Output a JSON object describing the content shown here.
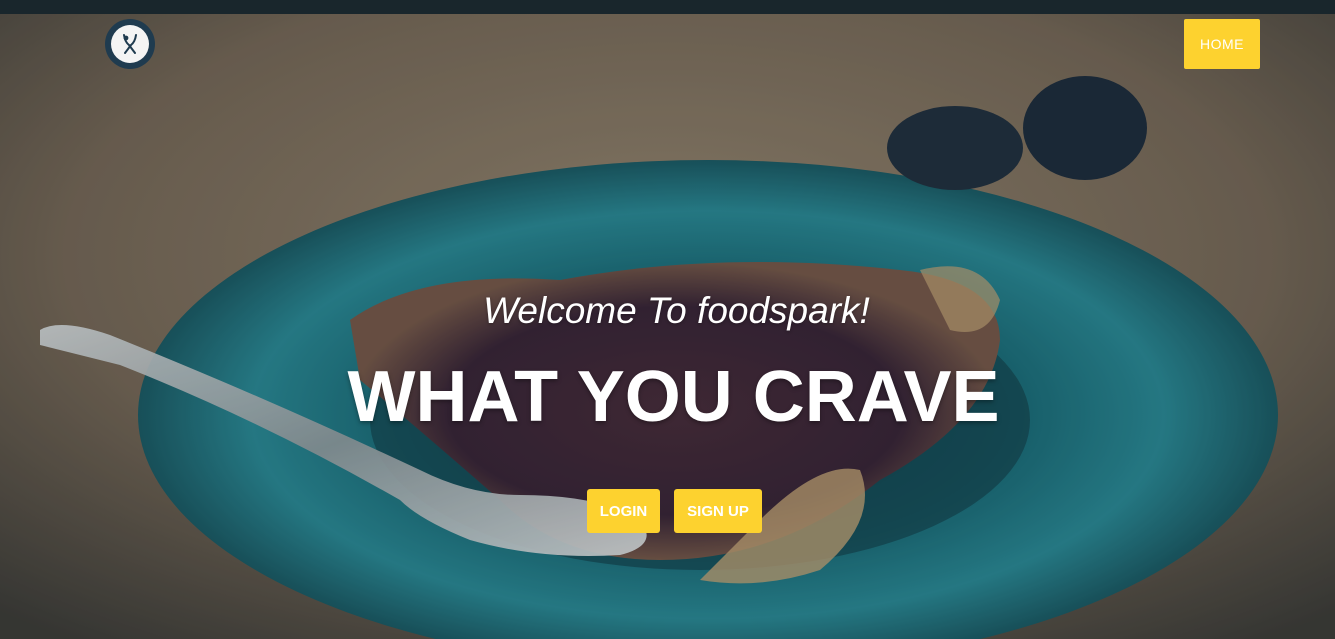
{
  "nav": {
    "logo_icon": "fork-spoon-icon",
    "home_label": "HOME"
  },
  "hero": {
    "welcome_text": "Welcome To foodspark!",
    "headline": "WHAT YOU CRAVE",
    "login_label": "LOGIN",
    "signup_label": "SIGN UP"
  },
  "colors": {
    "accent": "#fdd22f",
    "logo_ring": "#1f3b4f",
    "plate": "#1f7f8e"
  }
}
